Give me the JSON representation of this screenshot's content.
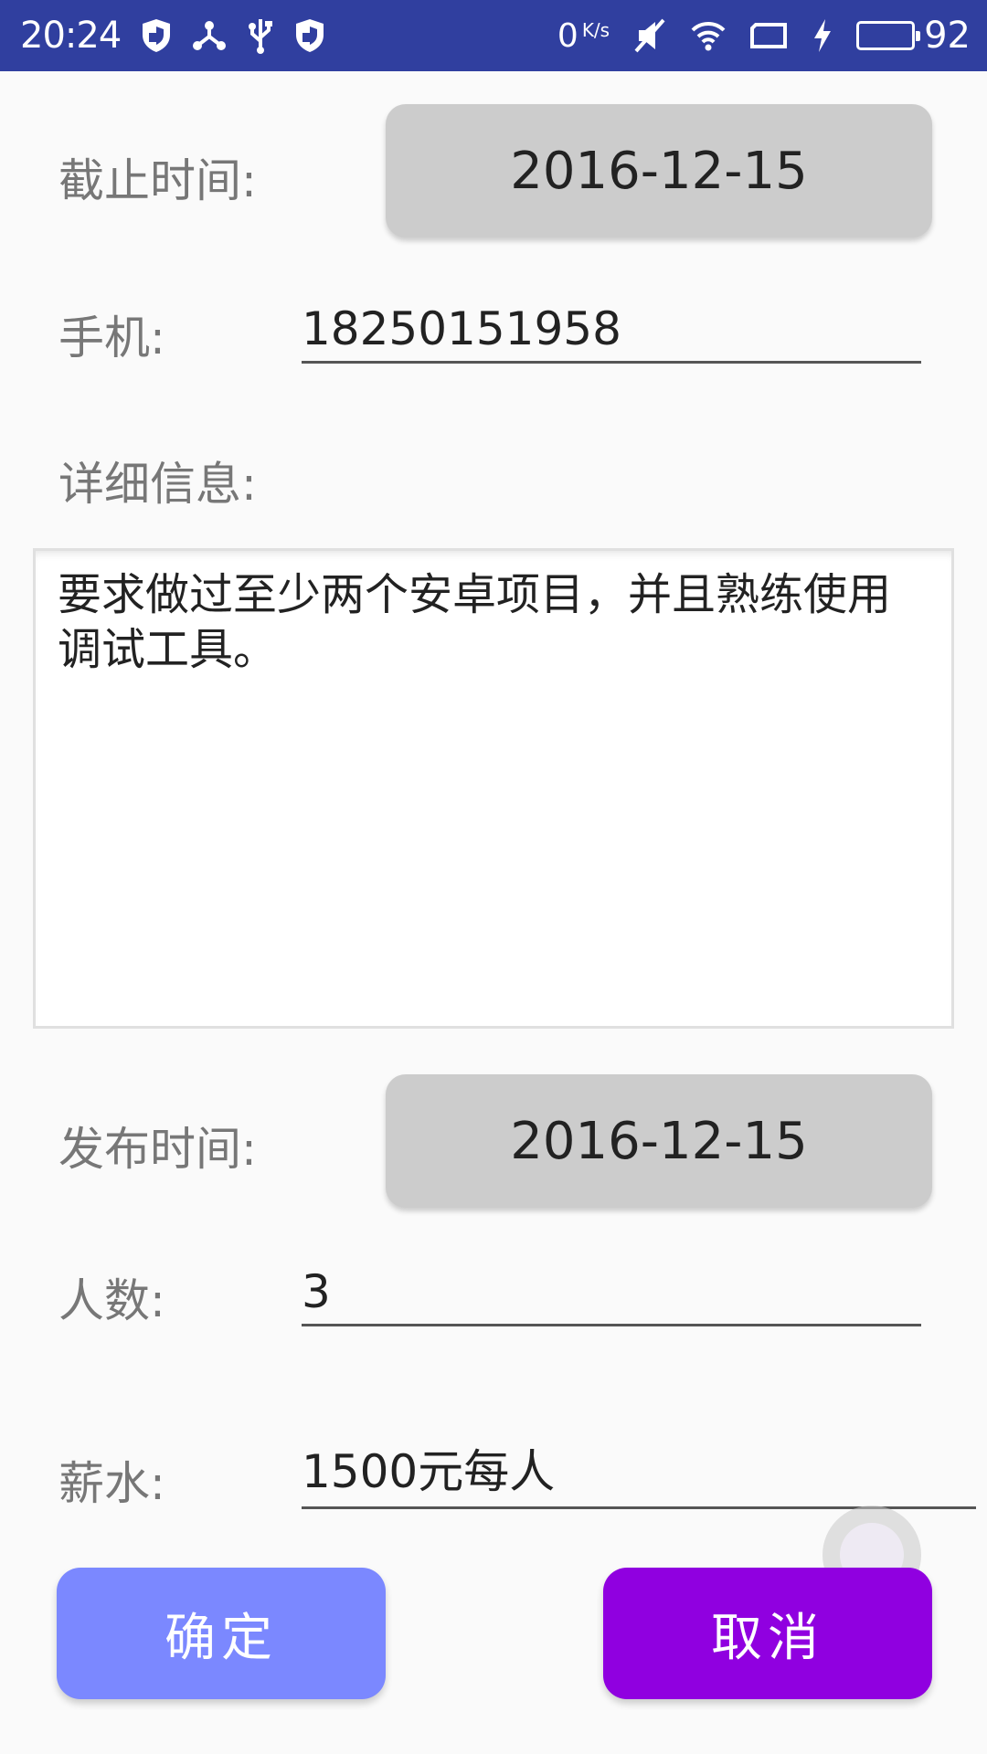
{
  "status_bar": {
    "time": "20:24",
    "speed_value": "0",
    "speed_unit": "K/s",
    "battery_level": "92",
    "battery_fraction": 0.92,
    "left_icons": [
      "shield-icon",
      "network-icon",
      "usb-icon",
      "shield-icon"
    ],
    "right_icons": [
      "mute-icon",
      "wifi-icon",
      "screen-icon",
      "charging-icon"
    ],
    "colors": {
      "background": "#303f9f",
      "battery": "#22d122"
    }
  },
  "form": {
    "deadline_label": "截止时间:",
    "deadline_value": "2016-12-15",
    "phone_label": "手机:",
    "phone_value": "18250151958",
    "detail_label": "详细信息:",
    "detail_value": "要求做过至少两个安卓项目，并且熟练使用调试工具。",
    "publish_label": "发布时间:",
    "publish_value": "2016-12-15",
    "count_label": "人数:",
    "count_value": "3",
    "salary_label": "薪水:",
    "salary_value": "1500元每人"
  },
  "buttons": {
    "confirm_label": "确定",
    "cancel_label": "取消",
    "colors": {
      "confirm": "#7b88ff",
      "cancel": "#9000e0"
    }
  }
}
